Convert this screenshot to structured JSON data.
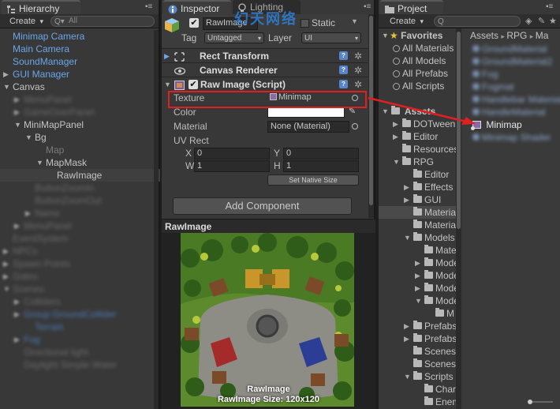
{
  "hierarchy": {
    "tab_label": "Hierarchy",
    "create_label": "Create",
    "search_placeholder": "All",
    "rows": [
      {
        "label": "Minimap Camera",
        "style": "blue",
        "indent": 16
      },
      {
        "label": "Main Camera",
        "style": "blue",
        "indent": 16
      },
      {
        "label": "SoundManager",
        "style": "blue",
        "indent": 16
      },
      {
        "label": "GUI Manager",
        "style": "blue",
        "indent": 16,
        "arrow": "right"
      },
      {
        "label": "Canvas",
        "style": "normal",
        "indent": 16,
        "arrow": "down"
      },
      {
        "label": "MenuPanel",
        "style": "blurred",
        "indent": 30,
        "arrow": "right"
      },
      {
        "label": "GameOverPanel",
        "style": "blurred",
        "indent": 30,
        "arrow": "right"
      },
      {
        "label": "MiniMapPanel",
        "style": "normal",
        "indent": 30,
        "arrow": "down"
      },
      {
        "label": "Bg",
        "style": "normal",
        "indent": 44,
        "arrow": "down"
      },
      {
        "label": "Map",
        "style": "grey",
        "indent": 58
      },
      {
        "label": "MapMask",
        "style": "normal",
        "indent": 58,
        "arrow": "down"
      },
      {
        "label": "RawImage",
        "style": "normal",
        "indent": 72,
        "selected": true
      },
      {
        "label": "ButtonZoomIn",
        "style": "blurred",
        "indent": 44
      },
      {
        "label": "ButtonZoomOut",
        "style": "blurred",
        "indent": 44
      },
      {
        "label": "Name",
        "style": "blurred",
        "indent": 44,
        "arrow": "right"
      },
      {
        "label": "MenuPanel",
        "style": "blurred",
        "indent": 30,
        "arrow": "right"
      },
      {
        "label": "EventSystem",
        "style": "blurred",
        "indent": 16
      },
      {
        "label": "NPCs",
        "style": "blurred",
        "indent": 16,
        "arrow": "right"
      },
      {
        "label": "Spawn Points",
        "style": "blurred",
        "indent": 16,
        "arrow": "right"
      },
      {
        "label": "Gates",
        "style": "blurred",
        "indent": 16,
        "arrow": "right"
      },
      {
        "label": "Scenes",
        "style": "blurred",
        "indent": 16,
        "arrow": "down"
      },
      {
        "label": "Colliders",
        "style": "blurred",
        "indent": 30,
        "arrow": "right"
      },
      {
        "label": "Group GroundCollider",
        "style": "blurblue",
        "indent": 30,
        "arrow": "right"
      },
      {
        "label": "Terrain",
        "style": "blurblue",
        "indent": 44
      },
      {
        "label": "Fog",
        "style": "blurblue",
        "indent": 30,
        "arrow": "right"
      },
      {
        "label": "Directional light",
        "style": "blurred",
        "indent": 30
      },
      {
        "label": "Daylight Simple Water",
        "style": "blurred",
        "indent": 30
      }
    ]
  },
  "inspector": {
    "tab_label": "Inspector",
    "tab2_label": "Lighting",
    "watermark": "幻天网络",
    "object_name": "RawImage",
    "static_label": "Static",
    "tag_label": "Tag",
    "tag_value": "Untagged",
    "layer_label": "Layer",
    "layer_value": "UI",
    "components": [
      {
        "name": "Rect Transform"
      },
      {
        "name": "Canvas Renderer"
      },
      {
        "name": "Raw Image (Script)"
      }
    ],
    "texture_label": "Texture",
    "texture_value": "Minimap",
    "color_label": "Color",
    "material_label": "Material",
    "material_value": "None (Material)",
    "uvrect_label": "UV Rect",
    "x_label": "X",
    "x_value": "0",
    "y_label": "Y",
    "y_value": "0",
    "w_label": "W",
    "w_value": "1",
    "h_label": "H",
    "h_value": "1",
    "native_size_label": "Set Native Size",
    "add_component_label": "Add Component",
    "preview_title": "RawImage",
    "preview_caption1": "RawImage",
    "preview_caption2": "RawImage Size: 120x120"
  },
  "project": {
    "tab_label": "Project",
    "create_label": "Create",
    "favorites_label": "Favorites",
    "favorites": [
      "All Materials",
      "All Models",
      "All Prefabs",
      "All Scripts"
    ],
    "breadcrumb": [
      "Assets",
      "RPG",
      "Ma"
    ],
    "assets_label": "Assets",
    "tree": [
      {
        "label": "DOTween",
        "indent": 14,
        "arrow": "right"
      },
      {
        "label": "Editor",
        "indent": 14,
        "arrow": "right"
      },
      {
        "label": "Resources",
        "indent": 14
      },
      {
        "label": "RPG",
        "indent": 14,
        "arrow": "down"
      },
      {
        "label": "Editor",
        "indent": 28
      },
      {
        "label": "Effects",
        "indent": 28,
        "arrow": "right"
      },
      {
        "label": "GUI",
        "indent": 28,
        "arrow": "right"
      },
      {
        "label": "Materials",
        "indent": 28,
        "selected": true
      },
      {
        "label": "Materials",
        "indent": 28
      },
      {
        "label": "Models",
        "indent": 28,
        "arrow": "down"
      },
      {
        "label": "Materials",
        "indent": 42
      },
      {
        "label": "Models",
        "indent": 42,
        "arrow": "right"
      },
      {
        "label": "Models",
        "indent": 42,
        "arrow": "right"
      },
      {
        "label": "Models",
        "indent": 42,
        "arrow": "right"
      },
      {
        "label": "Models",
        "indent": 42,
        "arrow": "down"
      },
      {
        "label": "M",
        "indent": 56
      },
      {
        "label": "Prefabs",
        "indent": 28,
        "arrow": "right"
      },
      {
        "label": "Prefabs",
        "indent": 28,
        "arrow": "right"
      },
      {
        "label": "Scenes",
        "indent": 28
      },
      {
        "label": "Scenes",
        "indent": 28
      },
      {
        "label": "Scripts",
        "indent": 28,
        "arrow": "down"
      },
      {
        "label": "Characters",
        "indent": 42
      },
      {
        "label": "Enemies",
        "indent": 42
      }
    ],
    "files_top": [
      "GroundMaterial",
      "GroundMaterial2",
      "Fog",
      "Fogmat",
      "Handlebar Material",
      "HandleMaterial"
    ],
    "minimap_label": "Minimap",
    "files_bottom": [
      "Minimap Shader"
    ]
  }
}
